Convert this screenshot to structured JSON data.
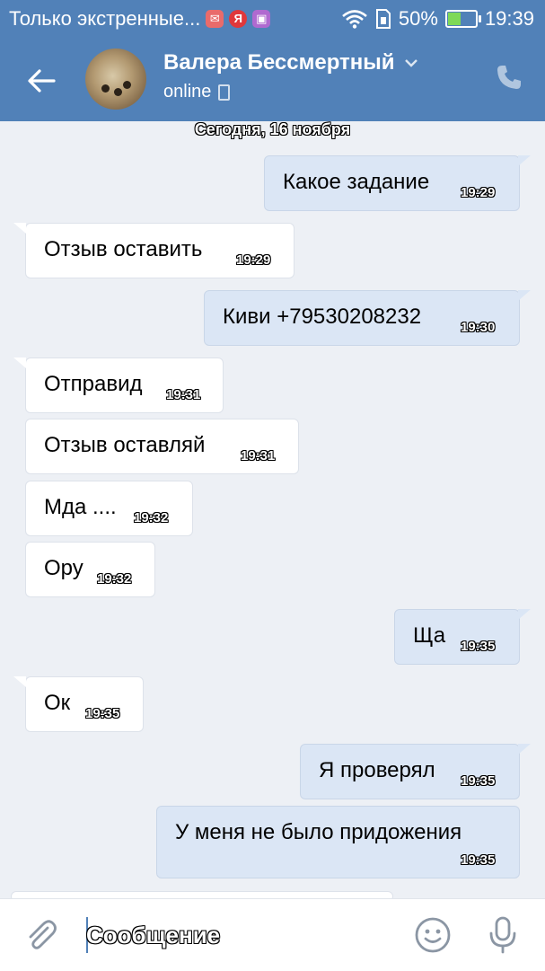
{
  "status": {
    "left_text": "Только экстренные...",
    "battery": "50%",
    "battery_level": 0.5,
    "time": "19:39"
  },
  "header": {
    "contact_name": "Валера Бессмертный",
    "presence": "online"
  },
  "date_divider": "Сегодня, 16 ноября",
  "messages": [
    {
      "dir": "out",
      "text": "Какое задание",
      "time": "19:29"
    },
    {
      "dir": "in",
      "text": "Отзыв оставить",
      "time": "19:29"
    },
    {
      "dir": "out",
      "text": "Киви +79530208232",
      "time": "19:30"
    },
    {
      "dir": "in",
      "text": "Отправид",
      "time": "19:31"
    },
    {
      "dir": "in",
      "text": "Отзыв оставляй",
      "time": "19:31"
    },
    {
      "dir": "in",
      "text": "Мда ....",
      "time": "19:32"
    },
    {
      "dir": "in",
      "text": "Ору",
      "time": "19:32"
    },
    {
      "dir": "out",
      "text": "Ща",
      "time": "19:35"
    },
    {
      "dir": "in",
      "text": "Ок",
      "time": "19:35"
    },
    {
      "dir": "out",
      "text": "Я проверял",
      "time": "19:35"
    },
    {
      "dir": "out",
      "text": "У меня не было придожения",
      "time": "19:35"
    }
  ],
  "composer": {
    "placeholder": "Сообщение"
  },
  "icons": {
    "back": "back-arrow-icon",
    "call": "phone-call-icon",
    "attach": "paperclip-icon",
    "emoji": "smile-icon",
    "mic": "microphone-icon"
  },
  "colors": {
    "header": "#5181b8",
    "outgoing_bubble": "#dbe6f5",
    "incoming_bubble": "#ffffff",
    "background": "#edf0f5"
  }
}
